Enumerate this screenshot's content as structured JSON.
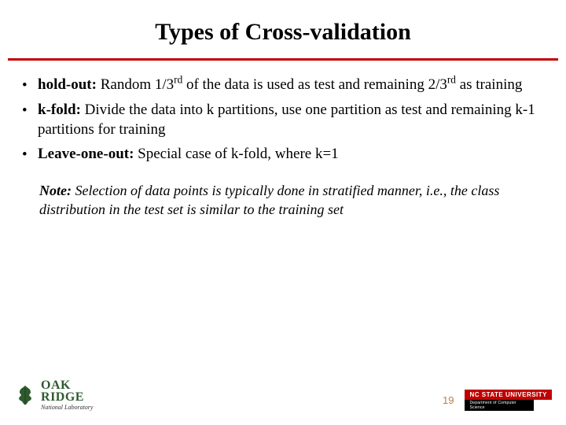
{
  "title": "Types of Cross-validation",
  "bullets": [
    {
      "term": "hold-out:",
      "pre": " Random 1/3",
      "sup1": "rd",
      "mid": " of the data is used as test and remaining 2/3",
      "sup2": "rd",
      "post": " as training"
    },
    {
      "term": "k-fold:",
      "rest": " Divide the data into k partitions, use one partition as test and remaining k-1 partitions for training"
    },
    {
      "term": "Leave-one-out:",
      "rest": " Special case of k-fold, where k=1"
    }
  ],
  "note": {
    "label": "Note:",
    "text": " Selection of data points is typically done in stratified manner, i.e., the class distribution in the test set is similar to the training set"
  },
  "footer": {
    "ornl": {
      "line1a": "O",
      "line1b": "AK",
      "line2a": "R",
      "line2b": "IDGE",
      "sub": "National Laboratory"
    },
    "page": "19",
    "ncsu": {
      "top": "NC STATE UNIVERSITY",
      "bot": "Department of Computer Science"
    }
  },
  "colors": {
    "accent_red": "#c00000",
    "leaf_green": "#2e5a2e",
    "page_orange": "#b57d4a"
  }
}
